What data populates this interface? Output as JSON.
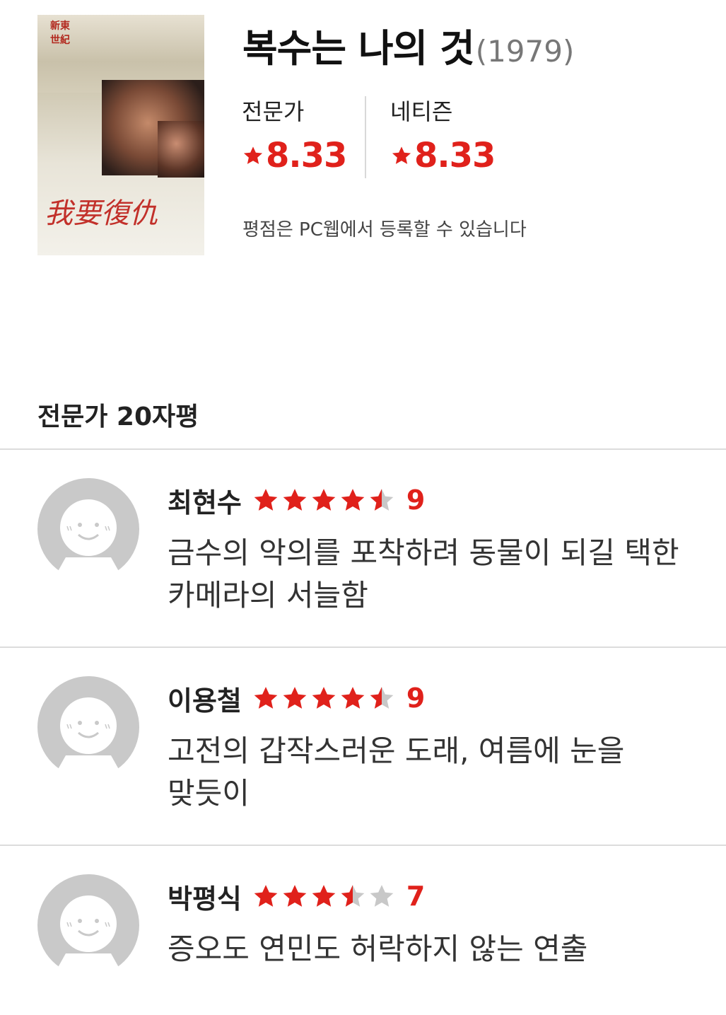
{
  "movie": {
    "title": "복수는 나의 것",
    "year": "(1979)",
    "poster": {
      "stamp_line1": "新東",
      "stamp_line2": "世紀",
      "calligraphy": "我要復仇"
    }
  },
  "ratings": {
    "expert": {
      "label": "전문가",
      "value": "8.33"
    },
    "netizen": {
      "label": "네티즌",
      "value": "8.33"
    },
    "star_color": "#e0211b"
  },
  "pc_note": "평점은 PC웹에서 등록할 수 있습니다",
  "reviews_section": {
    "title": "전문가 20자평",
    "items": [
      {
        "reviewer": "최현수",
        "score": "9",
        "stars_out_of_5": 4.5,
        "comment": "금수의 악의를 포착하려 동물이 되길 택한 카메라의 서늘함"
      },
      {
        "reviewer": "이용철",
        "score": "9",
        "stars_out_of_5": 4.5,
        "comment": "고전의 갑작스러운 도래, 여름에 눈을 맞듯이"
      },
      {
        "reviewer": "박평식",
        "score": "7",
        "stars_out_of_5": 3.5,
        "comment": "증오도 연민도 허락하지 않는 연출"
      }
    ]
  },
  "colors": {
    "accent_red": "#e0211b",
    "star_empty": "#c8c8c8",
    "avatar_gray": "#c9c9c9",
    "divider": "#dcdcdc"
  }
}
